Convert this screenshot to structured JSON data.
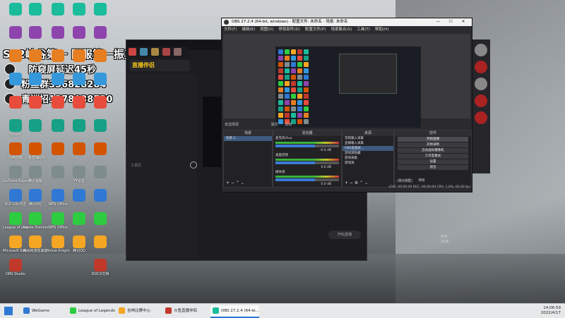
{
  "overlay": {
    "title": "S12峡谷第一 国服第一振克",
    "line2": "防窥屏延迟45秒",
    "line3": "粉丝群336828284",
    "line4": "青训招1378038730"
  },
  "desktop": {
    "col1": [
      "",
      "",
      "",
      "",
      "",
      "Steam",
      "控制面板",
      "GeForce Experience",
      "KLP-LOL日志",
      "League of Legends",
      "Microsoft Edge",
      "OBS Studio"
    ],
    "col2": [
      "",
      "",
      "",
      "",
      "",
      "",
      "斗鱼直播助手",
      "腾讯视频",
      "腾讯QQ",
      "Adobe Premiere",
      "腾讯网游加速器"
    ],
    "col3": [
      "",
      "",
      "",
      "",
      "",
      "",
      "",
      "",
      "WPS Office",
      "WPS Office",
      "Holow Knight"
    ],
    "col4": [
      "",
      "",
      "",
      "",
      "",
      "",
      "",
      "YY语音",
      "",
      "",
      "腾讯QQ"
    ],
    "col5": [
      "",
      "",
      "",
      "",
      "",
      "",
      "",
      "",
      "",
      "",
      "",
      "DOCX文档"
    ]
  },
  "back_app": {
    "brand": "直播伴侣",
    "bottom_label": "开始直播",
    "side_label": "工具栏",
    "right_text": "SYS\n/文本"
  },
  "obs": {
    "title": "OBS 27.2.4 (64-bit, windows) - 配置文件: 未命名 - 场景: 未命名",
    "menu": [
      "文件(F)",
      "编辑(E)",
      "视图(V)",
      "停靠部件(D)",
      "配置文件(P)",
      "场景集合(S)",
      "工具(T)",
      "帮助(H)"
    ],
    "controls": {
      "min": "—",
      "max": "☐",
      "close": "✕"
    },
    "no_source_label": "未选择源",
    "tabs": {
      "properties": "属性",
      "filters": "滤镜"
    },
    "docks": {
      "scenes": {
        "header": "场景",
        "items": [
          "场景 2"
        ]
      },
      "mixer": {
        "header": "混音器",
        "channels": [
          {
            "name": "麦克风/Aux",
            "db": "-0.0 dB"
          },
          {
            "name": "桌面音频",
            "db": "0.0 dB"
          },
          {
            "name": "媒体源",
            "db": "0.0 dB"
          }
        ]
      },
      "sources": {
        "header": "来源",
        "items": [
          "音频输入采集",
          "直播输入采集",
          "OBS直播屏...",
          "游戏源隐藏",
          "游戏采集",
          "游戏源"
        ]
      },
      "transitions": {
        "header": "转场特效",
        "button": "淡入淡出",
        "extra": "转场"
      },
      "controls": {
        "header": "控件",
        "buttons": [
          "开始直播",
          "开始录制",
          "启动虚拟摄像机",
          "工作室模式",
          "设置",
          "退出"
        ]
      }
    },
    "status": "LIVE: 00:00:00   REC: 00:00:00   CPU: 1.9%, 60.00 fps"
  },
  "taskbar": {
    "items": [
      "WeGame",
      "League of Legends",
      "吉林比赛中心",
      "斗鱼直播伴侣",
      "OBS 27.2.4 (64-bi..."
    ],
    "active": 4,
    "time": "14:06:59",
    "date": "2022/4/17"
  },
  "colors": {
    "accent": "#2f78d4",
    "obs_bg": "#2b2b2e",
    "selected": "#3d5a80"
  }
}
